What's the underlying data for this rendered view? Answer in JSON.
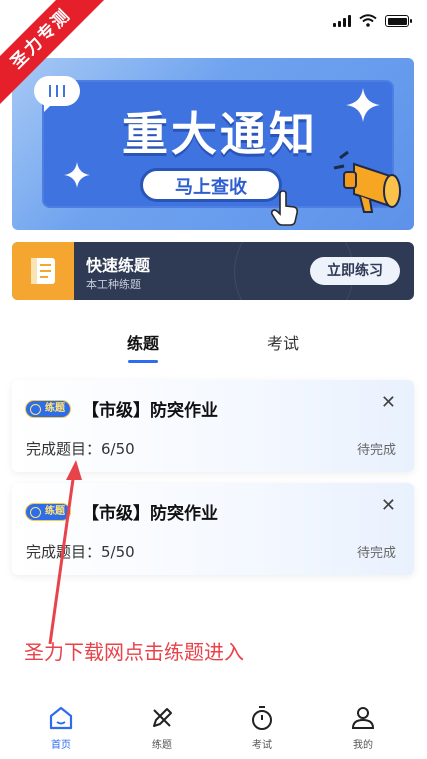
{
  "watermark": "圣力专测",
  "banner": {
    "title": "重大通知",
    "button_label": "马上查收"
  },
  "quick_practice": {
    "title": "快速练题",
    "subtitle": "本工种练题",
    "button_label": "立即练习"
  },
  "tabs": [
    {
      "label": "练题",
      "active": true
    },
    {
      "label": "考试",
      "active": false
    }
  ],
  "tasks": [
    {
      "badge": "练题",
      "title": "【市级】防突作业",
      "progress_label": "完成题目：6/50",
      "status": "待完成"
    },
    {
      "badge": "练题",
      "title": "【市级】防突作业",
      "progress_label": "完成题目：5/50",
      "status": "待完成"
    }
  ],
  "annotation": "圣力下载网点击练题进入",
  "bottom_nav": [
    {
      "label": "首页",
      "icon": "home-icon",
      "active": true
    },
    {
      "label": "练题",
      "icon": "pencil-icon",
      "active": false
    },
    {
      "label": "考试",
      "icon": "stopwatch-icon",
      "active": false
    },
    {
      "label": "我的",
      "icon": "user-icon",
      "active": false
    }
  ],
  "colors": {
    "accent": "#2d6cf0",
    "banner_blue": "#3f73e0",
    "quick_card_bg": "#2f3a55",
    "quick_icon_bg": "#f5a630",
    "annotation_red": "#e8434a",
    "watermark_red": "#e5202a"
  }
}
